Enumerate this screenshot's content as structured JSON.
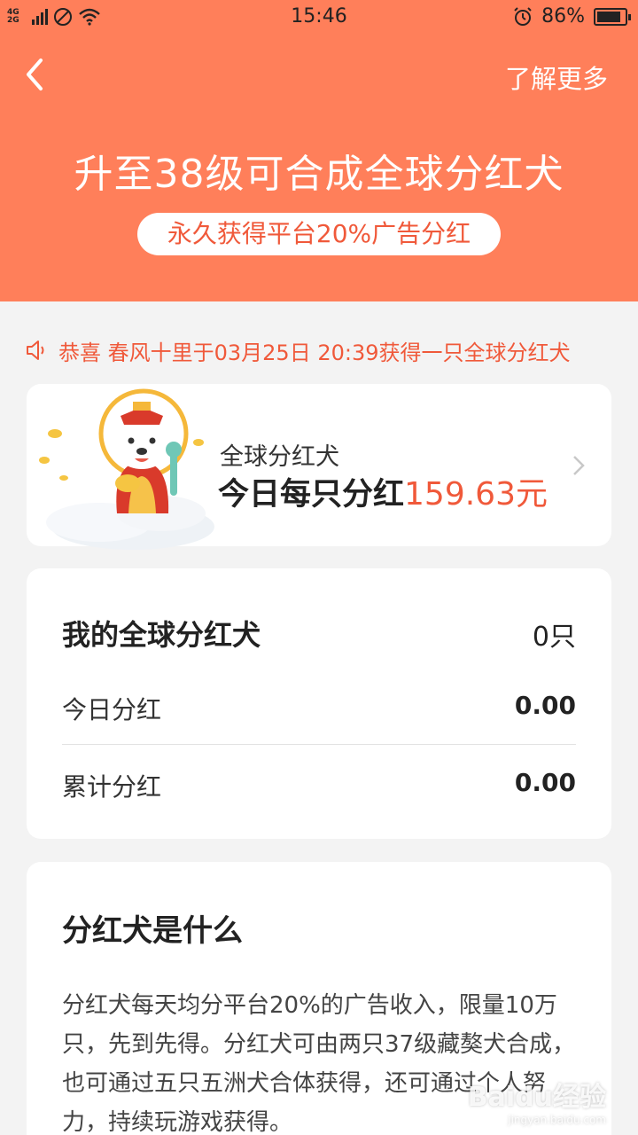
{
  "status_bar": {
    "network": "4G 2G",
    "time": "15:46",
    "battery": "86%",
    "battery_level": 0.86
  },
  "header": {
    "back_icon": "chevron-left-icon",
    "more_label": "了解更多",
    "title": "升至38级可合成全球分红犬",
    "pill_text": "永久获得平台20%广告分红",
    "bg_color": "#ff7f5a",
    "accent_color": "#f0593a"
  },
  "notice": {
    "icon": "speaker-icon",
    "text": "恭喜 春风十里于03月25日 20:39获得一只全球分红犬"
  },
  "dividend_card": {
    "name": "全球分红犬",
    "line_prefix": "今日每只分红",
    "amount": "159.63元"
  },
  "my_card": {
    "title": "我的全球分红犬",
    "count": "0只",
    "rows": [
      {
        "label": "今日分红",
        "value": "0.00"
      },
      {
        "label": "累计分红",
        "value": "0.00"
      }
    ]
  },
  "info_card": {
    "title": "分红犬是什么",
    "body": "分红犬每天均分平台20%的广告收入，限量10万只，先到先得。分红犬可由两只37级藏獒犬合成，也可通过五只五洲犬合体获得，还可通过个人努力，持续玩游戏获得。"
  },
  "watermark": {
    "text": "Baidu经验",
    "sub": "jingyan.baidu.com"
  }
}
